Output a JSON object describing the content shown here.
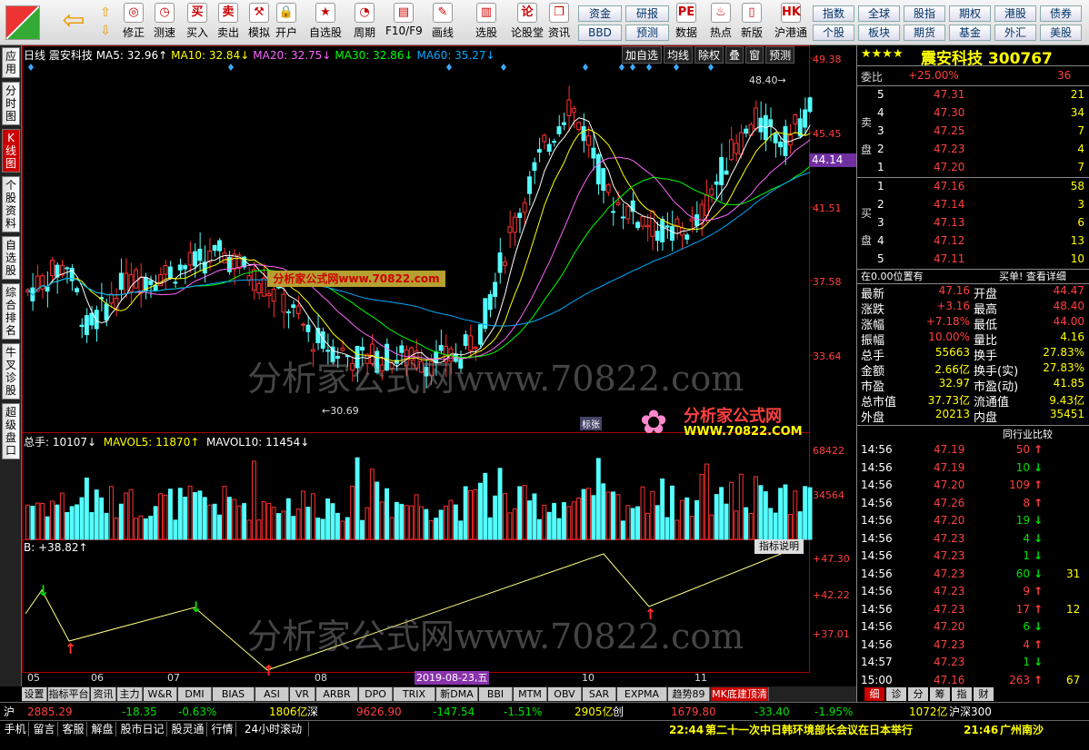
{
  "toolbar": {
    "left": [
      "修正",
      "测速",
      "买入",
      "卖出",
      "模拟",
      "开户",
      "自选股",
      "周期",
      "F10/F9",
      "画线",
      "选股",
      "论股堂",
      "资讯",
      "数据",
      "热点",
      "新版",
      "沪港通"
    ],
    "small1": [
      "资金",
      "研报",
      "BBD",
      "预测"
    ],
    "small2": [
      "指数",
      "全球",
      "股指",
      "期权",
      "港股",
      "债券",
      "个股",
      "板块",
      "期货",
      "基金",
      "外汇",
      "美股"
    ]
  },
  "sidebar": [
    "应用",
    "分时图",
    "K线图",
    "个股资料",
    "自选股",
    "综合排名",
    "牛叉诊股",
    "超级盘口"
  ],
  "chart": {
    "period": "日线",
    "name": "震安科技",
    "ma": [
      {
        "t": "MA5: 32.96↑",
        "c": "#ffffff"
      },
      {
        "t": "MA10: 32.84↓",
        "c": "#ffff00"
      },
      {
        "t": "MA20: 32.75↓",
        "c": "#ff66ff"
      },
      {
        "t": "MA30: 32.86↓",
        "c": "#00ff00"
      },
      {
        "t": "MA60: 35.27↓",
        "c": "#00aaff"
      }
    ],
    "tools": [
      "加自选",
      "均线",
      "除权",
      "叠",
      "窗",
      "预测"
    ],
    "yticks": [
      "49.38",
      "45.45",
      "41.51",
      "37.58",
      "33.64"
    ],
    "current": "44.14",
    "high": "48.40",
    "low": "30.69",
    "vol_title": "总手: 10107↓",
    "mavol5": "MAVOL5: 11870↑",
    "mavol10": "MAVOL10: 11454↓",
    "vticks": [
      "68422",
      "34564"
    ],
    "ind_title": "B: +38.82↑",
    "ind_btn": "指标说明",
    "iticks": [
      "+47.30",
      "+42.22",
      "+37.01"
    ],
    "months": [
      "05",
      "06",
      "07",
      "08",
      "10",
      "11"
    ],
    "date": "2019-08-23,五",
    "watermark": "分析家公式网www.70822.com",
    "logo": "分析家公式网",
    "logo2": "WWW.70822.COM",
    "flag": "标张"
  },
  "tabs": [
    "设置",
    "指标平台",
    "资讯",
    "主力",
    "W&R",
    "DMI",
    "BIAS",
    "ASI",
    "VR",
    "ARBR",
    "DPO",
    "TRIX",
    "新DMA",
    "BBI",
    "MTM",
    "OBV",
    "SAR",
    "EXPMA",
    "趋势89",
    "MK底建顶清"
  ],
  "quote": {
    "stars": "★★★★",
    "title": "震安科技 300767",
    "weibi": "委比",
    "weibi_v": "+25.00%",
    "weibi_n": "36",
    "sell_lbl": "卖盘",
    "buy_lbl": "买盘",
    "sell": [
      [
        "5",
        "47.31",
        "21"
      ],
      [
        "4",
        "47.30",
        "34"
      ],
      [
        "3",
        "47.25",
        "7"
      ],
      [
        "2",
        "47.23",
        "4"
      ],
      [
        "1",
        "47.20",
        "7"
      ]
    ],
    "buy": [
      [
        "1",
        "47.16",
        "58"
      ],
      [
        "2",
        "47.14",
        "3"
      ],
      [
        "3",
        "47.13",
        "6"
      ],
      [
        "4",
        "47.12",
        "13"
      ],
      [
        "5",
        "47.11",
        "10"
      ]
    ],
    "note": "在0.00位置有",
    "note2": "买单! 查看详细",
    "stats": [
      [
        "最新",
        "47.16",
        "开盘",
        "44.47"
      ],
      [
        "涨跌",
        "+3.16",
        "最高",
        "48.40"
      ],
      [
        "涨幅",
        "+7.18%",
        "最低",
        "44.00"
      ],
      [
        "振幅",
        "10.00%",
        "量比",
        "4.16"
      ],
      [
        "总手",
        "55663",
        "换手",
        "27.83%"
      ],
      [
        "金额",
        "2.66亿",
        "换手(实)",
        "27.83%"
      ],
      [
        "市盈",
        "32.97",
        "市盈(动)",
        "41.85"
      ],
      [
        "总市值",
        "37.73亿",
        "流通值",
        "9.43亿"
      ],
      [
        "外盘",
        "20213",
        "内盘",
        "35451"
      ]
    ],
    "compare": "同行业比较",
    "ticks": [
      [
        "14:56",
        "47.19",
        "50",
        "u"
      ],
      [
        "14:56",
        "47.19",
        "10",
        "d"
      ],
      [
        "14:56",
        "47.20",
        "109",
        "u"
      ],
      [
        "14:56",
        "47.26",
        "8",
        "u"
      ],
      [
        "14:56",
        "47.20",
        "19",
        "d"
      ],
      [
        "14:56",
        "47.23",
        "4",
        "d"
      ],
      [
        "14:56",
        "47.23",
        "1",
        "d"
      ],
      [
        "14:56",
        "47.23",
        "60",
        "d"
      ],
      [
        "14:56",
        "47.23",
        "9",
        "u"
      ],
      [
        "14:56",
        "47.23",
        "17",
        "u"
      ],
      [
        "14:56",
        "47.20",
        "6",
        "d"
      ],
      [
        "14:56",
        "47.23",
        "4",
        "u"
      ],
      [
        "14:57",
        "47.23",
        "1",
        "d"
      ],
      [
        "15:00",
        "47.16",
        "263",
        "u"
      ]
    ],
    "ticks_extra": [
      "",
      "",
      "",
      "",
      "",
      "",
      "",
      "31",
      "",
      "12",
      "",
      "",
      "",
      "67"
    ],
    "rtabs": [
      "细",
      "诊",
      "分",
      "筹",
      "指",
      "财"
    ]
  },
  "index": {
    "sh_name": "沪",
    "sh": "2885.29",
    "sh_chg": "-18.35",
    "sh_pct": "-0.63%",
    "sh_amt": "1806亿",
    "sz_name": "深",
    "sz": "9626.90",
    "sz_chg": "-147.54",
    "sz_pct": "-1.51%",
    "sz_amt": "2905亿",
    "cy_name": "创",
    "cy": "1679.80",
    "cy_chg": "-33.40",
    "cy_pct": "-1.95%",
    "cy_amt": "1072亿",
    "hs": "沪深300"
  },
  "bottom": {
    "items": [
      "手机",
      "留言",
      "客服",
      "解盘",
      "股市日记",
      "股灵通",
      "行情",
      "24小时滚动"
    ],
    "news1_time": "22:44",
    "news1": "第二十一次中日韩环境部长会议在日本举行",
    "news2_time": "21:46",
    "news2": "广州南沙"
  }
}
